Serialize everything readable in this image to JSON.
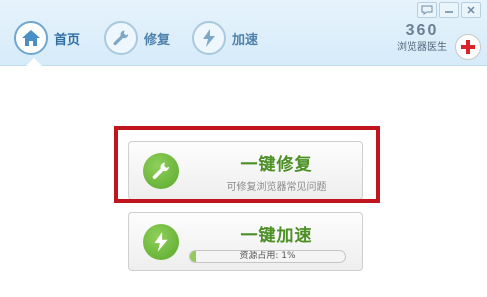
{
  "nav": {
    "items": [
      {
        "label": "首页",
        "icon": "home-icon",
        "active": true
      },
      {
        "label": "修复",
        "icon": "wrench-icon",
        "active": false
      },
      {
        "label": "加速",
        "icon": "lightning-icon",
        "active": false
      }
    ]
  },
  "window": {
    "buttons": [
      "feedback-icon",
      "minimize-icon",
      "close-icon"
    ]
  },
  "brand": {
    "number": "360",
    "subtitle": "浏览器医生",
    "logo": "red-cross-logo"
  },
  "actions": {
    "repair": {
      "title": "一键修复",
      "subtitle": "可修复浏览器常见问题",
      "icon": "wrench-icon"
    },
    "speed": {
      "title": "一键加速",
      "progress_text": "资源占用: 1%",
      "progress_value": 0.01,
      "icon": "lightning-icon"
    }
  },
  "colors": {
    "accent_green": "#4c8f24",
    "header_blue": "#d6ebf9",
    "highlight_red": "#c0151c"
  }
}
